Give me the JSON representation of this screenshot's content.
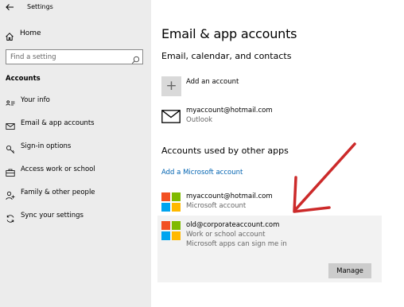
{
  "window": {
    "title": "Settings"
  },
  "sidebar": {
    "home_label": "Home",
    "search_placeholder": "Find a setting",
    "section_label": "Accounts",
    "items": [
      {
        "label": "Your info",
        "icon": "user-card-icon"
      },
      {
        "label": "Email & app accounts",
        "icon": "mail-icon"
      },
      {
        "label": "Sign-in options",
        "icon": "key-icon"
      },
      {
        "label": "Access work or school",
        "icon": "briefcase-icon"
      },
      {
        "label": "Family & other people",
        "icon": "person-add-icon"
      },
      {
        "label": "Sync your settings",
        "icon": "sync-icon"
      }
    ]
  },
  "main": {
    "title": "Email & app accounts",
    "section1_heading": "Email, calendar, and contacts",
    "add_account_label": "Add an account",
    "email_account": {
      "address": "myaccount@hotmail.com",
      "provider": "Outlook"
    },
    "section2_heading": "Accounts used by other apps",
    "add_ms_account_link": "Add a Microsoft account",
    "app_accounts": [
      {
        "address": "myaccount@hotmail.com",
        "type": "Microsoft account"
      },
      {
        "address": "old@corporateaccount.com",
        "type": "Work or school account",
        "note": "Microsoft apps can sign me in"
      }
    ],
    "manage_label": "Manage"
  },
  "colors": {
    "accent_link": "#0063b1",
    "annotation_arrow": "#cc2a2a",
    "ms_red": "#f25022",
    "ms_green": "#7fba00",
    "ms_blue": "#00a4ef",
    "ms_yellow": "#ffb900"
  }
}
